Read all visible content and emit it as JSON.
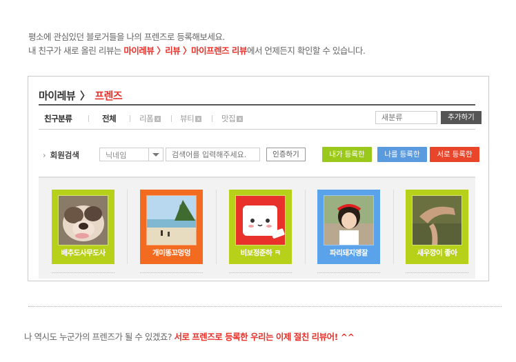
{
  "intro": {
    "line1": "평소에 관심있던 블로거들을 나의 프렌즈로 등록해보세요.",
    "line2_pre": "내 친구가 새로 올린 리뷰는 ",
    "line2_hl": "마이레뷰 〉리뷰 〉마이프렌즈 리뷰",
    "line2_post": "에서 언제든지 확인할 수 있습니다."
  },
  "panel": {
    "title": "마이레뷰",
    "title_sep": "〉",
    "subtitle": "프렌즈",
    "tabs": [
      {
        "label": "친구분류",
        "close": ""
      },
      {
        "label": "전체",
        "close": ""
      },
      {
        "label": "리폼",
        "close": "x"
      },
      {
        "label": "뷰티",
        "close": "x"
      },
      {
        "label": "맛집",
        "close": "x"
      }
    ],
    "new_category_placeholder": "새분류",
    "add_button": "추가하기",
    "search": {
      "arrow": "›",
      "label": "회원검색",
      "select_value": "닉네임",
      "keyword_placeholder": "검색어를 입력해주세요.",
      "search_button": "인증하기"
    },
    "filters": {
      "mine": "내가 등록한",
      "me": "나를 등록한",
      "mutual": "서로 등록한"
    },
    "friends": [
      {
        "name": "배추도사무도사",
        "color": "green"
      },
      {
        "name": "개미똥꼬멍멍",
        "color": "orange"
      },
      {
        "name": "비보정준하 ㅋ",
        "color": "green"
      },
      {
        "name": "파리돼지앵잘",
        "color": "blue"
      },
      {
        "name": "새우깡이 좋아",
        "color": "green"
      }
    ]
  },
  "outro": {
    "pre": "나 역시도 누군가의 프렌즈가 될 수 있겠죠? ",
    "hl": "서로 프렌즈로 등록한 우리는 이제 절친 리뷰어! ^^"
  },
  "colors": {
    "accent_red": "#e8312a",
    "green": "#b7d11b",
    "orange": "#f26b21",
    "blue": "#5aa3ea"
  }
}
